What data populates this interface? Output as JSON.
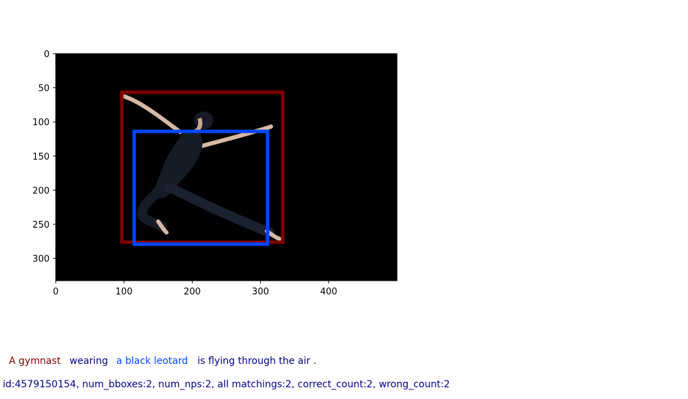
{
  "image": {
    "subject": "ballet dancer leaping mid-air on a black background",
    "background_color": "#000000"
  },
  "axes": {
    "x_ticks": [
      "0",
      "100",
      "200",
      "300",
      "400"
    ],
    "y_ticks": [
      "0",
      "50",
      "100",
      "150",
      "200",
      "250",
      "300"
    ]
  },
  "boxes": [
    {
      "phrase": "A gymnast",
      "color": "#7f0000"
    },
    {
      "phrase": "a black leotard",
      "color": "#0046ff"
    }
  ],
  "caption": {
    "segments": [
      {
        "text": "A gymnast",
        "color": "#7f0000"
      },
      {
        "text": "wearing",
        "color": "#00007f"
      },
      {
        "text": "a black leotard",
        "color": "#0046ff"
      },
      {
        "text": "is flying through the air .",
        "color": "#00007f"
      }
    ]
  },
  "info": "id:4579150154, num_bboxes:2, num_nps:2, all matchings:2, correct_count:2, wrong_count:2"
}
